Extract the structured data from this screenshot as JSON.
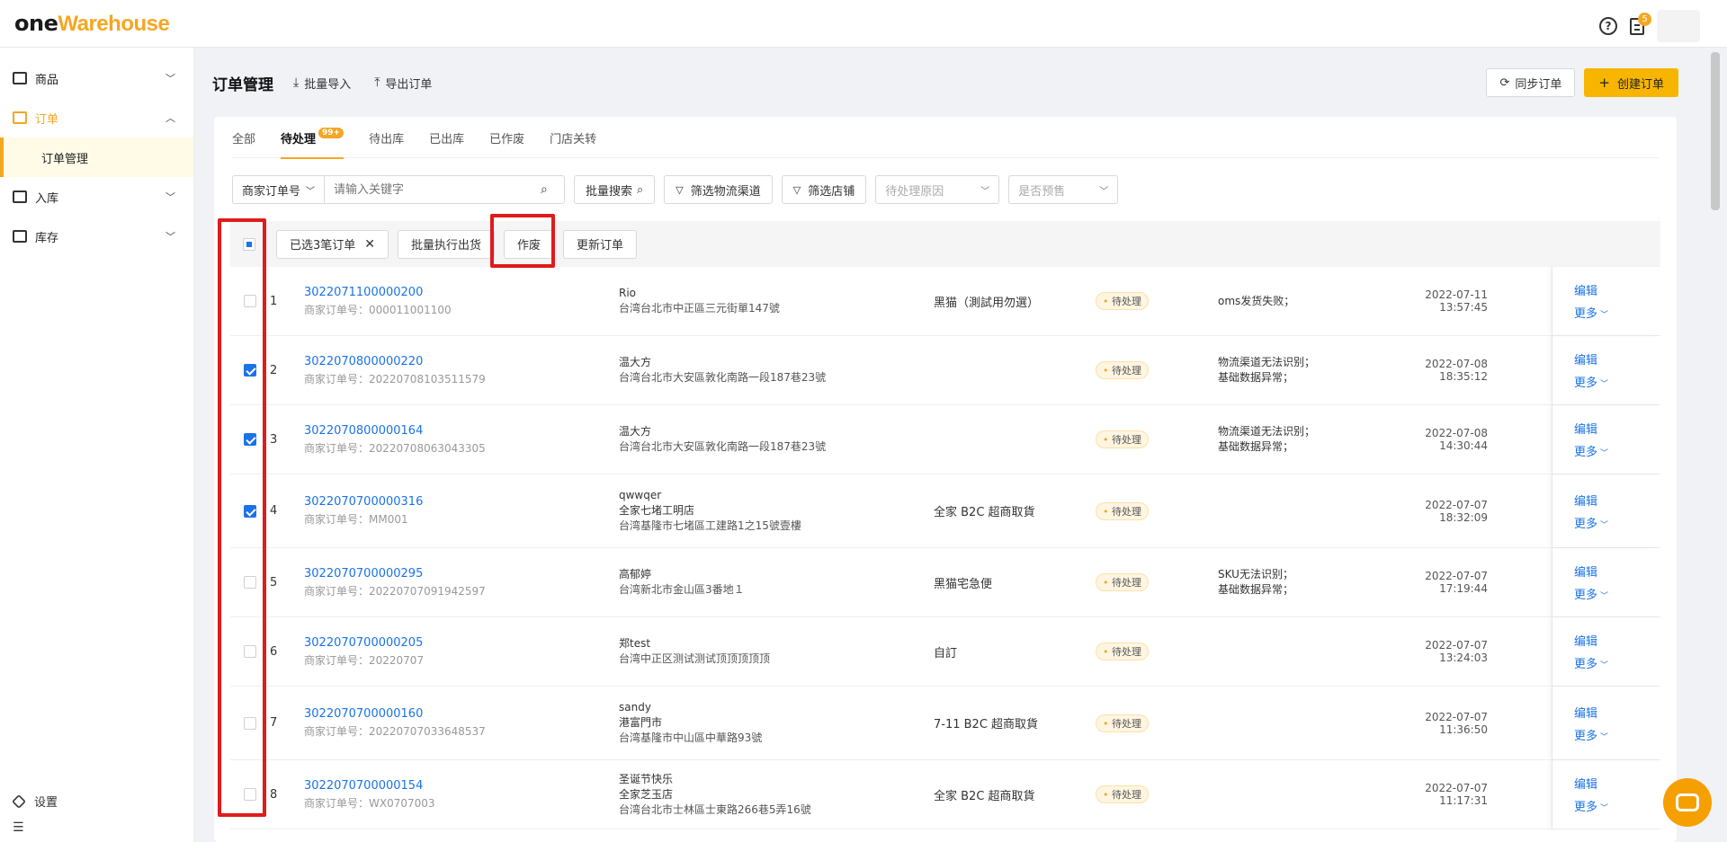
{
  "header": {
    "logo_one": "one",
    "logo_warehouse": "Warehouse",
    "notification_count": "5"
  },
  "sidebar": {
    "items": [
      {
        "label": "商品",
        "icon": "bag-icon"
      },
      {
        "label": "订单",
        "icon": "order-icon"
      },
      {
        "sub_label": "订单管理"
      },
      {
        "label": "入库",
        "icon": "store-icon"
      },
      {
        "label": "库存",
        "icon": "warehouse-icon"
      }
    ],
    "settings_label": "设置"
  },
  "page": {
    "title": "订单管理",
    "import_label": "批量导入",
    "export_label": "导出订单",
    "sync_label": "同步订单",
    "create_label": "创建订单"
  },
  "tabs": [
    {
      "label": "全部"
    },
    {
      "label": "待处理",
      "count": "99+"
    },
    {
      "label": "待出库"
    },
    {
      "label": "已出库"
    },
    {
      "label": "已作废"
    },
    {
      "label": "门店关转"
    }
  ],
  "filters": {
    "field_select": "商家订单号",
    "keyword_placeholder": "请输入关键字",
    "batch_search": "批量搜索",
    "filter_channel": "筛选物流渠道",
    "filter_store": "筛选店铺",
    "reason_placeholder": "待处理原因",
    "presale_placeholder": "是否预售"
  },
  "actionbar": {
    "selected_label": "已选3笔订单",
    "batch_ship": "批量执行出货",
    "void": "作废",
    "update": "更新订单"
  },
  "rows": [
    {
      "idx": "1",
      "checked": false,
      "order_no": "3022071100000200",
      "merchant_no": "商家订单号：000011001100",
      "recv": [
        "Rio",
        "台湾台北市中正區三元街單147號"
      ],
      "ship": "黑猫（測試用勿選）",
      "status": "待处理",
      "reason": [
        "oms发货失败；"
      ],
      "time": "2022-07-11 13:57:45"
    },
    {
      "idx": "2",
      "checked": true,
      "order_no": "3022070800000220",
      "merchant_no": "商家订单号：20220708103511579",
      "recv": [
        "温大方",
        "台湾台北市大安區敦化南路一段187巷23號"
      ],
      "ship": "",
      "status": "待处理",
      "reason": [
        "物流渠道无法识别；",
        "基础数据异常；"
      ],
      "time": "2022-07-08 18:35:12"
    },
    {
      "idx": "3",
      "checked": true,
      "order_no": "3022070800000164",
      "merchant_no": "商家订单号：20220708063043305",
      "recv": [
        "温大方",
        "台湾台北市大安區敦化南路一段187巷23號"
      ],
      "ship": "",
      "status": "待处理",
      "reason": [
        "物流渠道无法识别；",
        "基础数据异常；"
      ],
      "time": "2022-07-08 14:30:44"
    },
    {
      "idx": "4",
      "checked": true,
      "order_no": "3022070700000316",
      "merchant_no": "商家订单号：MM001",
      "recv": [
        "qwwqer",
        "全家七堵工明店",
        "台湾基隆市七堵區工建路1之15號壹樓"
      ],
      "ship": "全家 B2C 超商取貨",
      "status": "待处理",
      "reason": [],
      "time": "2022-07-07 18:32:09"
    },
    {
      "idx": "5",
      "checked": false,
      "order_no": "3022070700000295",
      "merchant_no": "商家订单号：20220707091942597",
      "recv": [
        "高郁婷",
        "台湾新北市金山區3番地１"
      ],
      "ship": "黑猫宅急便",
      "status": "待处理",
      "reason": [
        "SKU无法识别；",
        "基础数据异常；"
      ],
      "time": "2022-07-07 17:19:44"
    },
    {
      "idx": "6",
      "checked": false,
      "order_no": "3022070700000205",
      "merchant_no": "商家订单号：20220707",
      "recv": [
        "郑test",
        "台湾中正区测试测试顶顶顶顶顶"
      ],
      "ship": "自訂",
      "status": "待处理",
      "reason": [],
      "time": "2022-07-07 13:24:03"
    },
    {
      "idx": "7",
      "checked": false,
      "order_no": "3022070700000160",
      "merchant_no": "商家订单号：20220707033648537",
      "recv": [
        "sandy",
        "港富門市",
        "台湾基隆市中山區中華路93號"
      ],
      "ship": "7-11 B2C 超商取貨",
      "status": "待处理",
      "reason": [],
      "time": "2022-07-07 11:36:50"
    },
    {
      "idx": "8",
      "checked": false,
      "order_no": "3022070700000154",
      "merchant_no": "商家订单号：WX0707003",
      "recv": [
        "圣诞节快乐",
        "全家芝玉店",
        "台湾台北市士林區士東路266巷5弄16號"
      ],
      "ship": "全家 B2C 超商取貨",
      "status": "待处理",
      "reason": [],
      "time": "2022-07-07 11:17:31"
    }
  ],
  "row_actions": {
    "edit": "编辑",
    "more": "更多"
  }
}
